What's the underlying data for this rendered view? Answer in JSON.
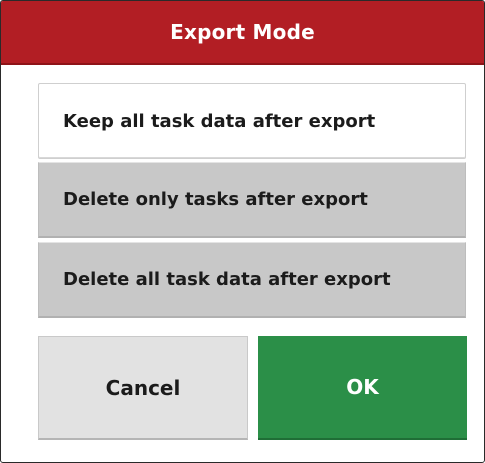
{
  "dialog": {
    "title": "Export Mode",
    "options": [
      {
        "label": "Keep all task data after export",
        "selected": true
      },
      {
        "label": "Delete only tasks after export",
        "selected": false
      },
      {
        "label": "Delete all task data after export",
        "selected": false
      }
    ],
    "buttons": {
      "cancel_label": "Cancel",
      "ok_label": "OK"
    },
    "colors": {
      "title_bar": "#b21e24",
      "ok_button": "#2b8f48",
      "unselected_option": "#c8c8c8",
      "cancel_button": "#e2e2e2"
    }
  }
}
